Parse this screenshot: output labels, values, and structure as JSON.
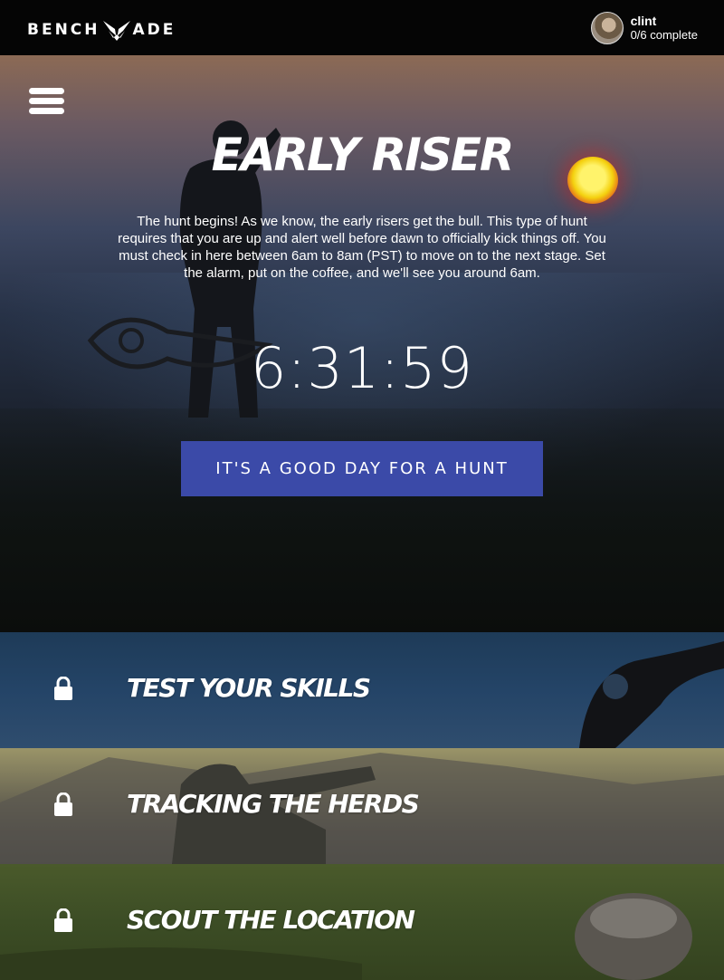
{
  "header": {
    "logo_part1": "BENCH",
    "logo_part2": "ADE",
    "user_name": "clint",
    "user_progress": "0/6 complete"
  },
  "hero": {
    "title": "EARLY RISER",
    "description": "The hunt begins! As we know, the early risers get the bull. This type of hunt requires that you are up and alert well before dawn to officially kick things off. You must check in here between 6am to 8am (PST) to move on to the next stage. Set the alarm, put on the coffee, and we'll see you around 6am.",
    "timer": "6:31:59",
    "button_label": "IT'S A GOOD DAY FOR A HUNT"
  },
  "stages": [
    {
      "label": "TEST YOUR SKILLS",
      "locked": true
    },
    {
      "label": "TRACKING THE HERDS",
      "locked": true
    },
    {
      "label": "SCOUT THE LOCATION",
      "locked": true
    }
  ],
  "colors": {
    "topbar": "#050505",
    "button": "#3b4aa8",
    "sun": "#f4d10f"
  },
  "icons": [
    "menu-icon",
    "lock-icon",
    "butterfly-logo-icon"
  ]
}
